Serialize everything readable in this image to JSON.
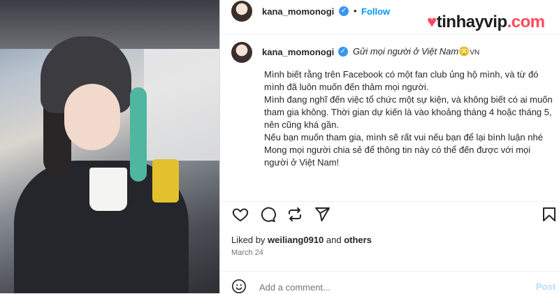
{
  "photo": {
    "alt": "photo"
  },
  "header": {
    "username": "kana_momonogi",
    "separator": "•",
    "follow": "Follow"
  },
  "watermark": {
    "heart": "♥",
    "name": "tinhayvip",
    "domain": ".com"
  },
  "caption": {
    "username": "kana_momonogi",
    "title": "Gửi mọi người ở Việt Nam",
    "emoji": "😳",
    "flag": "VN",
    "lines": [
      "Mình biết rằng trên Facebook có một fan club ủng hộ mình, và từ đó mình đã luôn muốn đến thăm mọi người.",
      "Mình đang nghĩ đến việc tổ chức một sự kiện, và không biết có ai muốn tham gia không. Thời gian dự kiến là vào khoảng tháng 4 hoặc tháng 5, nên cũng khá gần.",
      "Nếu bạn muốn tham gia, mình sẽ rất vui nếu bạn để lại bình luận nhé",
      "Mong mọi người chia sẻ để thông tin này có thể đến được với mọi người ở Việt Nam!"
    ]
  },
  "likes": {
    "prefix": "Liked by",
    "user": "weiliang0910",
    "and": "and",
    "others": "others"
  },
  "date": "March 24",
  "comment": {
    "placeholder": "Add a comment...",
    "post": "Post"
  },
  "colors": {
    "accent": "#0095f6",
    "verified": "#3897f0",
    "brand": "#ff4a5f"
  }
}
